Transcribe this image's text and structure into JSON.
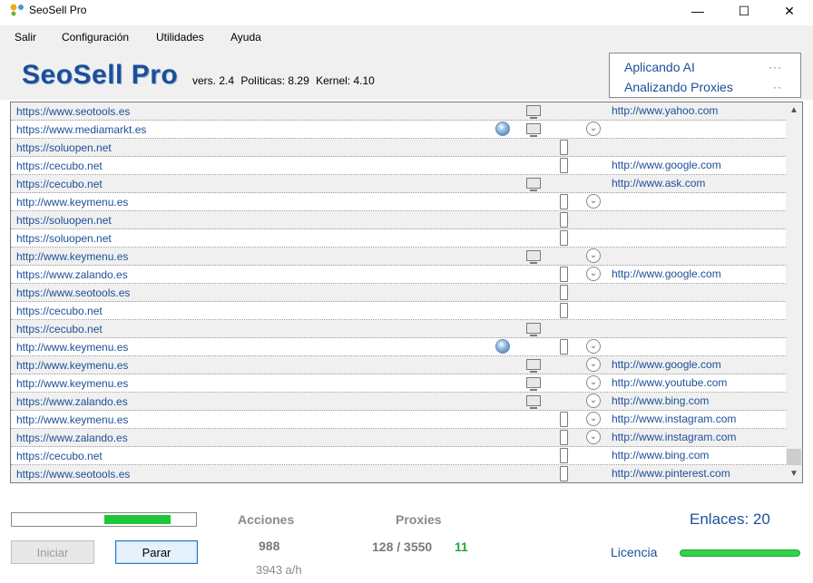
{
  "window": {
    "title": "SeoSell Pro",
    "controls": {
      "minimize": "—",
      "maximize": "☐",
      "close": "✕"
    }
  },
  "menu": [
    "Salir",
    "Configuración",
    "Utilidades",
    "Ayuda"
  ],
  "header": {
    "brand": "SeoSell Pro",
    "version": "vers. 2.4",
    "policies": "Políticas: 8.29",
    "kernel": "Kernel: 4.10"
  },
  "status": {
    "line1": "Aplicando AI",
    "line1_dots": "···",
    "line2": "Analizando Proxies",
    "line2_dots": "··"
  },
  "rows": [
    {
      "url": "https://www.seotools.es",
      "globe": false,
      "monitor": true,
      "phone": false,
      "circle": false,
      "engine": "http://www.yahoo.com"
    },
    {
      "url": "https://www.mediamarkt.es",
      "globe": true,
      "monitor": true,
      "phone": false,
      "circle": true,
      "engine": ""
    },
    {
      "url": "https://soluopen.net",
      "globe": false,
      "monitor": false,
      "phone": true,
      "circle": false,
      "engine": ""
    },
    {
      "url": "https://cecubo.net",
      "globe": false,
      "monitor": false,
      "phone": true,
      "circle": false,
      "engine": "http://www.google.com"
    },
    {
      "url": "https://cecubo.net",
      "globe": false,
      "monitor": true,
      "phone": false,
      "circle": false,
      "engine": "http://www.ask.com"
    },
    {
      "url": "http://www.keymenu.es",
      "globe": false,
      "monitor": false,
      "phone": true,
      "circle": true,
      "engine": ""
    },
    {
      "url": "https://soluopen.net",
      "globe": false,
      "monitor": false,
      "phone": true,
      "circle": false,
      "engine": ""
    },
    {
      "url": "https://soluopen.net",
      "globe": false,
      "monitor": false,
      "phone": true,
      "circle": false,
      "engine": ""
    },
    {
      "url": "http://www.keymenu.es",
      "globe": false,
      "monitor": true,
      "phone": false,
      "circle": true,
      "engine": ""
    },
    {
      "url": "https://www.zalando.es",
      "globe": false,
      "monitor": false,
      "phone": true,
      "circle": true,
      "engine": "http://www.google.com"
    },
    {
      "url": "https://www.seotools.es",
      "globe": false,
      "monitor": false,
      "phone": true,
      "circle": false,
      "engine": ""
    },
    {
      "url": "https://cecubo.net",
      "globe": false,
      "monitor": false,
      "phone": true,
      "circle": false,
      "engine": ""
    },
    {
      "url": "https://cecubo.net",
      "globe": false,
      "monitor": true,
      "phone": false,
      "circle": false,
      "engine": ""
    },
    {
      "url": "http://www.keymenu.es",
      "globe": true,
      "monitor": false,
      "phone": true,
      "circle": true,
      "engine": ""
    },
    {
      "url": "http://www.keymenu.es",
      "globe": false,
      "monitor": true,
      "phone": false,
      "circle": true,
      "engine": "http://www.google.com"
    },
    {
      "url": "http://www.keymenu.es",
      "globe": false,
      "monitor": true,
      "phone": false,
      "circle": true,
      "engine": "http://www.youtube.com"
    },
    {
      "url": "https://www.zalando.es",
      "globe": false,
      "monitor": true,
      "phone": false,
      "circle": true,
      "engine": "http://www.bing.com"
    },
    {
      "url": "http://www.keymenu.es",
      "globe": false,
      "monitor": false,
      "phone": true,
      "circle": true,
      "engine": "http://www.instagram.com"
    },
    {
      "url": "https://www.zalando.es",
      "globe": false,
      "monitor": false,
      "phone": true,
      "circle": true,
      "engine": "http://www.instagram.com"
    },
    {
      "url": "https://cecubo.net",
      "globe": false,
      "monitor": false,
      "phone": true,
      "circle": false,
      "engine": "http://www.bing.com"
    },
    {
      "url": "https://www.seotools.es",
      "globe": false,
      "monitor": false,
      "phone": true,
      "circle": false,
      "engine": "http://www.pinterest.com"
    }
  ],
  "progress": {
    "start_fraction": 0.5,
    "end_fraction": 0.86
  },
  "buttons": {
    "start": "Iniciar",
    "stop": "Parar"
  },
  "stats": {
    "actions_label": "Acciones",
    "actions_value": "988",
    "actions_rate": "3943 a/h",
    "proxies_label": "Proxies",
    "proxies_value": "128 / 3550",
    "proxies_active": "11"
  },
  "footer": {
    "links": "Enlaces: 20",
    "license": "Licencia"
  },
  "icons": {
    "logo": "app-logo-icon",
    "scroll_up": "chevron-up-icon",
    "scroll_down": "chevron-down-icon"
  }
}
